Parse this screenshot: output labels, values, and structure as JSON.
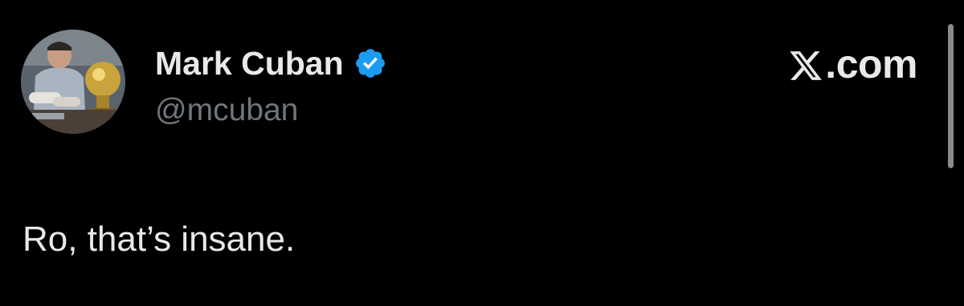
{
  "author": {
    "display_name": "Mark Cuban",
    "handle": "@mcuban",
    "verified": true,
    "avatar_icon": "profile-photo"
  },
  "brand": {
    "wordmark_suffix": ".com",
    "logo_icon": "x-logo-icon"
  },
  "tweet": {
    "text": "Ro, that’s insane."
  },
  "colors": {
    "background": "#000000",
    "primary_text": "#e7e9ea",
    "secondary_text": "#71767b",
    "verified_blue": "#1d9bf0"
  }
}
